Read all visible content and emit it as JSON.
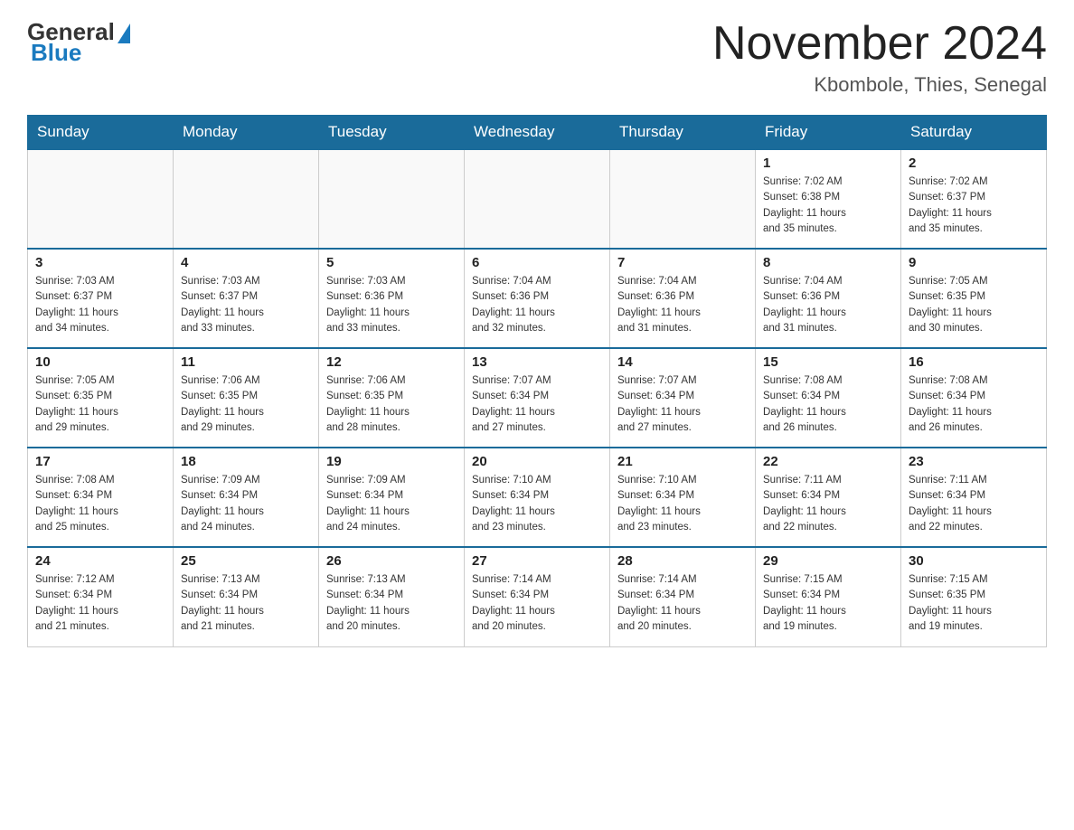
{
  "header": {
    "logo": {
      "general": "General",
      "blue": "Blue"
    },
    "title": "November 2024",
    "location": "Kbombole, Thies, Senegal"
  },
  "calendar": {
    "days_of_week": [
      "Sunday",
      "Monday",
      "Tuesday",
      "Wednesday",
      "Thursday",
      "Friday",
      "Saturday"
    ],
    "weeks": [
      [
        {
          "day": "",
          "info": ""
        },
        {
          "day": "",
          "info": ""
        },
        {
          "day": "",
          "info": ""
        },
        {
          "day": "",
          "info": ""
        },
        {
          "day": "",
          "info": ""
        },
        {
          "day": "1",
          "info": "Sunrise: 7:02 AM\nSunset: 6:38 PM\nDaylight: 11 hours\nand 35 minutes."
        },
        {
          "day": "2",
          "info": "Sunrise: 7:02 AM\nSunset: 6:37 PM\nDaylight: 11 hours\nand 35 minutes."
        }
      ],
      [
        {
          "day": "3",
          "info": "Sunrise: 7:03 AM\nSunset: 6:37 PM\nDaylight: 11 hours\nand 34 minutes."
        },
        {
          "day": "4",
          "info": "Sunrise: 7:03 AM\nSunset: 6:37 PM\nDaylight: 11 hours\nand 33 minutes."
        },
        {
          "day": "5",
          "info": "Sunrise: 7:03 AM\nSunset: 6:36 PM\nDaylight: 11 hours\nand 33 minutes."
        },
        {
          "day": "6",
          "info": "Sunrise: 7:04 AM\nSunset: 6:36 PM\nDaylight: 11 hours\nand 32 minutes."
        },
        {
          "day": "7",
          "info": "Sunrise: 7:04 AM\nSunset: 6:36 PM\nDaylight: 11 hours\nand 31 minutes."
        },
        {
          "day": "8",
          "info": "Sunrise: 7:04 AM\nSunset: 6:36 PM\nDaylight: 11 hours\nand 31 minutes."
        },
        {
          "day": "9",
          "info": "Sunrise: 7:05 AM\nSunset: 6:35 PM\nDaylight: 11 hours\nand 30 minutes."
        }
      ],
      [
        {
          "day": "10",
          "info": "Sunrise: 7:05 AM\nSunset: 6:35 PM\nDaylight: 11 hours\nand 29 minutes."
        },
        {
          "day": "11",
          "info": "Sunrise: 7:06 AM\nSunset: 6:35 PM\nDaylight: 11 hours\nand 29 minutes."
        },
        {
          "day": "12",
          "info": "Sunrise: 7:06 AM\nSunset: 6:35 PM\nDaylight: 11 hours\nand 28 minutes."
        },
        {
          "day": "13",
          "info": "Sunrise: 7:07 AM\nSunset: 6:34 PM\nDaylight: 11 hours\nand 27 minutes."
        },
        {
          "day": "14",
          "info": "Sunrise: 7:07 AM\nSunset: 6:34 PM\nDaylight: 11 hours\nand 27 minutes."
        },
        {
          "day": "15",
          "info": "Sunrise: 7:08 AM\nSunset: 6:34 PM\nDaylight: 11 hours\nand 26 minutes."
        },
        {
          "day": "16",
          "info": "Sunrise: 7:08 AM\nSunset: 6:34 PM\nDaylight: 11 hours\nand 26 minutes."
        }
      ],
      [
        {
          "day": "17",
          "info": "Sunrise: 7:08 AM\nSunset: 6:34 PM\nDaylight: 11 hours\nand 25 minutes."
        },
        {
          "day": "18",
          "info": "Sunrise: 7:09 AM\nSunset: 6:34 PM\nDaylight: 11 hours\nand 24 minutes."
        },
        {
          "day": "19",
          "info": "Sunrise: 7:09 AM\nSunset: 6:34 PM\nDaylight: 11 hours\nand 24 minutes."
        },
        {
          "day": "20",
          "info": "Sunrise: 7:10 AM\nSunset: 6:34 PM\nDaylight: 11 hours\nand 23 minutes."
        },
        {
          "day": "21",
          "info": "Sunrise: 7:10 AM\nSunset: 6:34 PM\nDaylight: 11 hours\nand 23 minutes."
        },
        {
          "day": "22",
          "info": "Sunrise: 7:11 AM\nSunset: 6:34 PM\nDaylight: 11 hours\nand 22 minutes."
        },
        {
          "day": "23",
          "info": "Sunrise: 7:11 AM\nSunset: 6:34 PM\nDaylight: 11 hours\nand 22 minutes."
        }
      ],
      [
        {
          "day": "24",
          "info": "Sunrise: 7:12 AM\nSunset: 6:34 PM\nDaylight: 11 hours\nand 21 minutes."
        },
        {
          "day": "25",
          "info": "Sunrise: 7:13 AM\nSunset: 6:34 PM\nDaylight: 11 hours\nand 21 minutes."
        },
        {
          "day": "26",
          "info": "Sunrise: 7:13 AM\nSunset: 6:34 PM\nDaylight: 11 hours\nand 20 minutes."
        },
        {
          "day": "27",
          "info": "Sunrise: 7:14 AM\nSunset: 6:34 PM\nDaylight: 11 hours\nand 20 minutes."
        },
        {
          "day": "28",
          "info": "Sunrise: 7:14 AM\nSunset: 6:34 PM\nDaylight: 11 hours\nand 20 minutes."
        },
        {
          "day": "29",
          "info": "Sunrise: 7:15 AM\nSunset: 6:34 PM\nDaylight: 11 hours\nand 19 minutes."
        },
        {
          "day": "30",
          "info": "Sunrise: 7:15 AM\nSunset: 6:35 PM\nDaylight: 11 hours\nand 19 minutes."
        }
      ]
    ]
  }
}
